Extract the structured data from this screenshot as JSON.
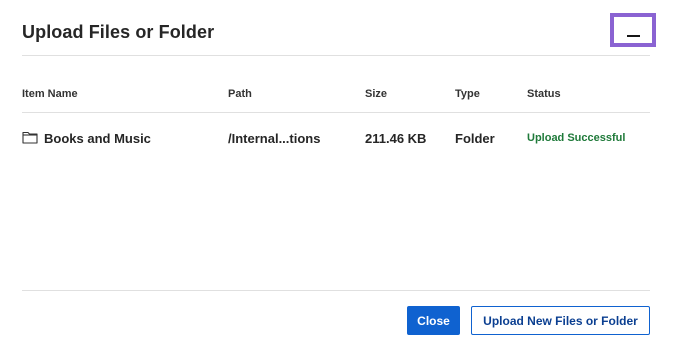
{
  "dialog": {
    "title": "Upload Files or Folder",
    "minimize_icon": "minus-icon"
  },
  "table": {
    "columns": [
      "Item Name",
      "Path",
      "Size",
      "Type",
      "Status"
    ],
    "rows": [
      {
        "icon": "folder-icon",
        "name": "Books and Music",
        "path": "/Internal...tions",
        "size": "211.46 KB",
        "type": "Folder",
        "status": "Upload Successful"
      }
    ]
  },
  "footer": {
    "close_label": "Close",
    "upload_label": "Upload New Files or Folder"
  },
  "colors": {
    "focus_outline": "#8a63d2",
    "primary": "#0f62d0",
    "success": "#1f7a3a"
  }
}
